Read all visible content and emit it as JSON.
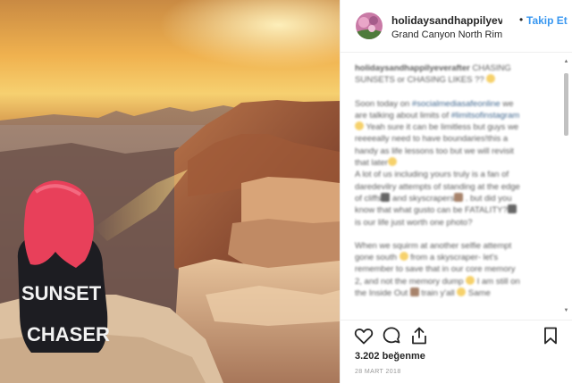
{
  "post": {
    "username": "holidaysandhappilyeverafter",
    "separator": "•",
    "follow_label": "Takip Et",
    "location": "Grand Canyon North Rim"
  },
  "photo": {
    "shirt_line1": "SUNSET",
    "shirt_line2": "CHASER"
  },
  "caption": {
    "author": "holidaysandhappilyeverafter",
    "line1": " CHASING SUNSETS or CHASING LIKES ?? ",
    "p2a": "Soon today on ",
    "tag1": "#socialmediasafeonline",
    "p2b": " we are talking about limits of ",
    "tag2": "#limitsofinstagram",
    "p2c": " Yeah sure it can be limitless but guys we reeeeally need to have boundaries!this a handy as life lessons too but we will revisit that later",
    "p3a": "A lot of us including yours truly is a fan of daredevilry attempts of standing at the edge of cliffs",
    "p3b": " and skyscrapers",
    "p3c": " . but did you know that what gusto can be FATALITY?",
    "p3d": " is our life just worth one photo?",
    "p4a": "When we squirm at another selfie attempt gone south ",
    "p4b": " from a skyscraper- let's remember to save that in our core memory 2, and not the memory dump ",
    "p4c": " I am still on the Inside Out ",
    "p4d": " train y'all ",
    "p4e": " Same"
  },
  "icons": {
    "like": "heart-icon",
    "comment": "comment-icon",
    "share": "share-icon",
    "save": "bookmark-icon"
  },
  "stats": {
    "likes": "3.202 beğenme",
    "date": "28 MART 2018"
  },
  "colors": {
    "follow": "#3897f0",
    "text": "#262626",
    "muted": "#999999",
    "hair": "#e8405a"
  }
}
